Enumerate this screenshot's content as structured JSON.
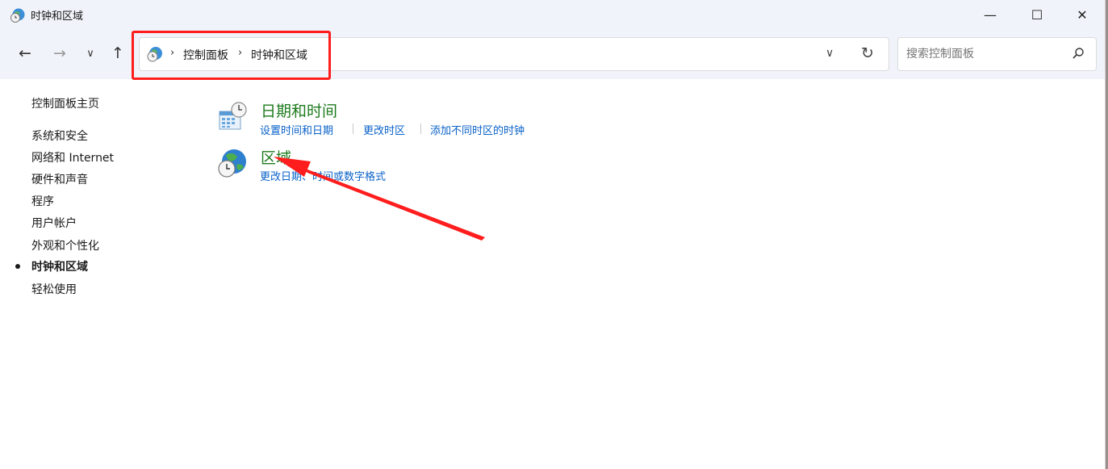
{
  "window": {
    "title": "时钟和区域",
    "icon": "clock-globe-icon",
    "controls": {
      "minimize": "—",
      "maximize": "☐",
      "close": "✕"
    }
  },
  "nav": {
    "back": "←",
    "forward": "→",
    "recent": "∨",
    "up": "↑",
    "breadcrumb": [
      "控制面板",
      "时钟和区域"
    ],
    "dropdown": "∨",
    "refresh": "↻"
  },
  "search": {
    "placeholder": "搜索控制面板"
  },
  "sidebar": {
    "items": [
      {
        "label": "控制面板主页",
        "active": false
      },
      {
        "label": "系统和安全",
        "active": false
      },
      {
        "label": "网络和 Internet",
        "active": false
      },
      {
        "label": "硬件和声音",
        "active": false
      },
      {
        "label": "程序",
        "active": false
      },
      {
        "label": "用户帐户",
        "active": false
      },
      {
        "label": "外观和个性化",
        "active": false
      },
      {
        "label": "时钟和区域",
        "active": true
      },
      {
        "label": "轻松使用",
        "active": false
      }
    ]
  },
  "categories": [
    {
      "title": "日期和时间",
      "icon": "calendar-clock-icon",
      "links": [
        "设置时间和日期",
        "更改时区",
        "添加不同时区的时钟"
      ]
    },
    {
      "title": "区域",
      "icon": "globe-clock-icon",
      "links": [
        "更改日期、时间或数字格式"
      ]
    }
  ],
  "annotations": {
    "highlight_color": "#ff1d1d",
    "arrow_color": "#ff1d1d"
  },
  "colors": {
    "category_title": "#1e7b1e",
    "link": "#0a62c9",
    "chrome_bg": "#f0f3f9"
  }
}
